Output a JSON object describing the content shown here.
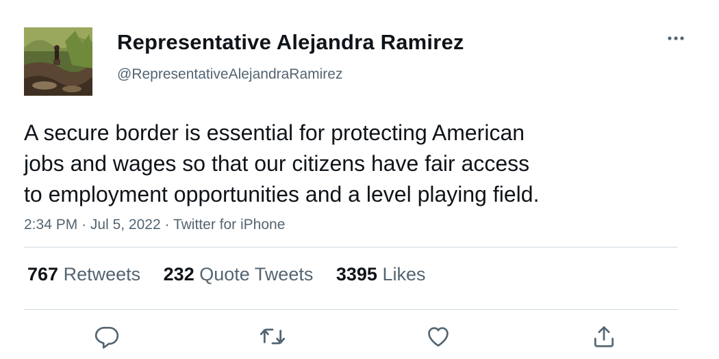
{
  "author": {
    "display_name": "Representative Alejandra Ramirez",
    "handle": "@RepresentativeAlejandraRamirez"
  },
  "tweet": {
    "lines": [
      "A secure border is essential for protecting American",
      "jobs and wages so that our citizens have fair access",
      "to employment opportunities and a level playing field."
    ],
    "time": "2:34 PM",
    "date": "Jul 5, 2022",
    "source": "Twitter for iPhone",
    "separator": "·"
  },
  "stats": {
    "retweets": {
      "count": "767",
      "label": "Retweets"
    },
    "quote_tweets": {
      "count": "232",
      "label": "Quote Tweets"
    },
    "likes": {
      "count": "3395",
      "label": "Likes"
    }
  },
  "icons": {
    "more": "more-horizontal-icon",
    "reply": "reply-icon",
    "retweet": "retweet-icon",
    "like": "heart-icon",
    "share": "share-icon"
  },
  "colors": {
    "text_primary": "#0f1419",
    "text_secondary": "#536471",
    "divider": "#cfd9de"
  }
}
